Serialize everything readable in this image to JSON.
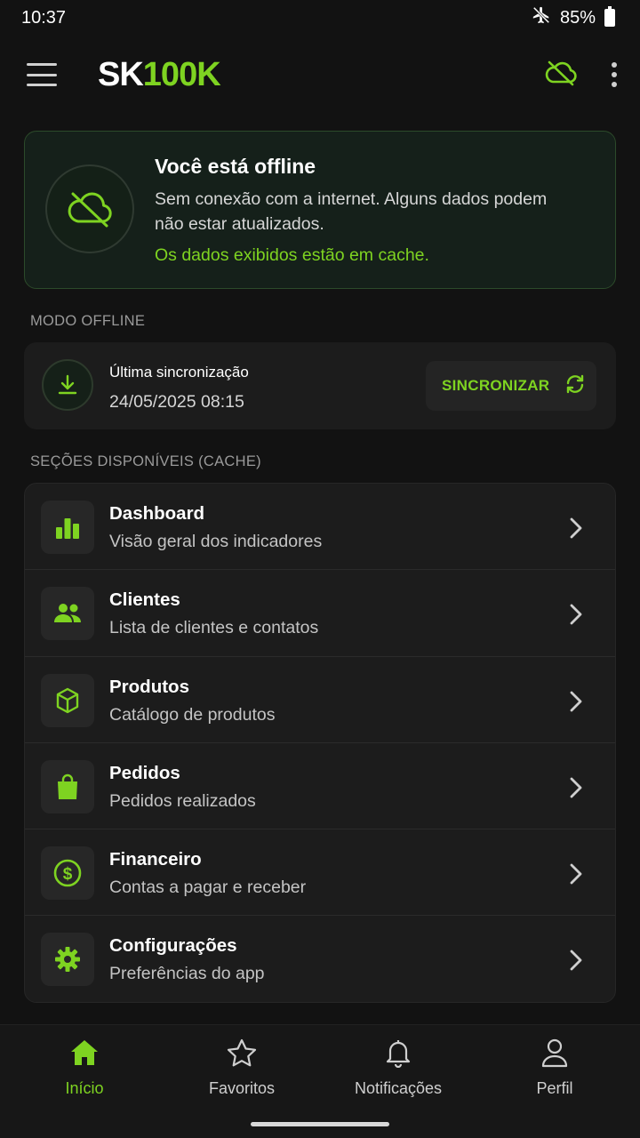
{
  "status": {
    "time": "10:37",
    "battery": "85%",
    "icons": [
      "airplane-mode-icon",
      "battery-icon"
    ]
  },
  "header": {
    "logo_main": "SK",
    "logo_accent": "100K",
    "actions": [
      "cloud-offline-icon",
      "more-vert-icon"
    ]
  },
  "offline_banner": {
    "title": "Você está offline",
    "message": "Sem conexão com a internet. Alguns dados podem não estar atualizados.",
    "cache_note": "Os dados exibidos estão em cache.",
    "icon": "cloud-off-icon"
  },
  "offline_mode": {
    "section_label": "MODO OFFLINE",
    "last_sync_label": "Última sincronização",
    "last_sync_value": "24/05/2025 08:15",
    "sync_button": "SINCRONIZAR"
  },
  "sections": {
    "label": "SEÇÕES DISPONÍVEIS (CACHE)",
    "items": [
      {
        "title": "Dashboard",
        "subtitle": "Visão geral dos indicadores",
        "icon": "bar-chart-icon"
      },
      {
        "title": "Clientes",
        "subtitle": "Lista de clientes e contatos",
        "icon": "people-icon"
      },
      {
        "title": "Produtos",
        "subtitle": "Catálogo de produtos",
        "icon": "cube-icon"
      },
      {
        "title": "Pedidos",
        "subtitle": "Pedidos realizados",
        "icon": "shopping-bag-icon"
      },
      {
        "title": "Financeiro",
        "subtitle": "Contas a pagar e receber",
        "icon": "dollar-circle-icon"
      },
      {
        "title": "Configurações",
        "subtitle": "Preferências do app",
        "icon": "gear-icon"
      }
    ]
  },
  "bottom_nav": {
    "items": [
      {
        "label": "Início",
        "icon": "home-icon",
        "active": true
      },
      {
        "label": "Favoritos",
        "icon": "star-icon",
        "active": false
      },
      {
        "label": "Notificações",
        "icon": "bell-icon",
        "active": false
      },
      {
        "label": "Perfil",
        "icon": "person-icon",
        "active": false
      }
    ]
  },
  "colors": {
    "accent": "#7ed321",
    "background": "#121212",
    "card": "#1c1c1c"
  }
}
